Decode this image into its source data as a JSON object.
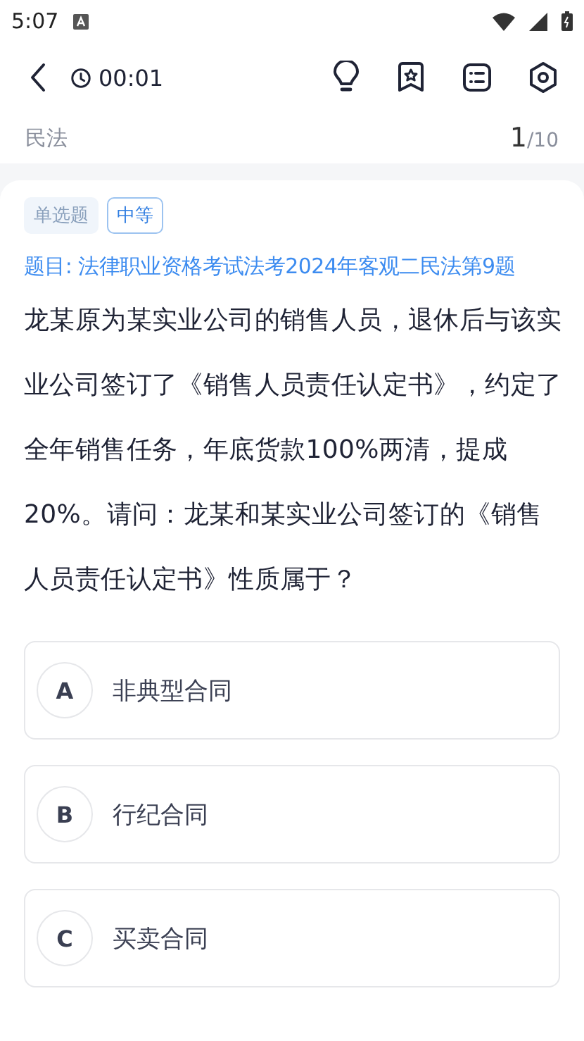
{
  "status_bar": {
    "time": "5:07"
  },
  "header": {
    "timer": "00:01"
  },
  "subject": {
    "name": "民法",
    "current": "1",
    "total": "/10"
  },
  "question": {
    "type_tag": "单选题",
    "difficulty_tag": "中等",
    "source": "题目: 法律职业资格考试法考2024年客观二民法第9题",
    "text": "龙某原为某实业公司的销售人员，退休后与该实业公司签订了《销售人员责任认定书》，约定了全年销售任务，年底货款100%两清，提成20%。请问：龙某和某实业公司签订的《销售人员责任认定书》性质属于？"
  },
  "options": [
    {
      "letter": "A",
      "text": "非典型合同",
      "selected": false
    },
    {
      "letter": "B",
      "text": "行纪合同",
      "selected": false
    },
    {
      "letter": "C",
      "text": "买卖合同",
      "selected": false
    }
  ]
}
